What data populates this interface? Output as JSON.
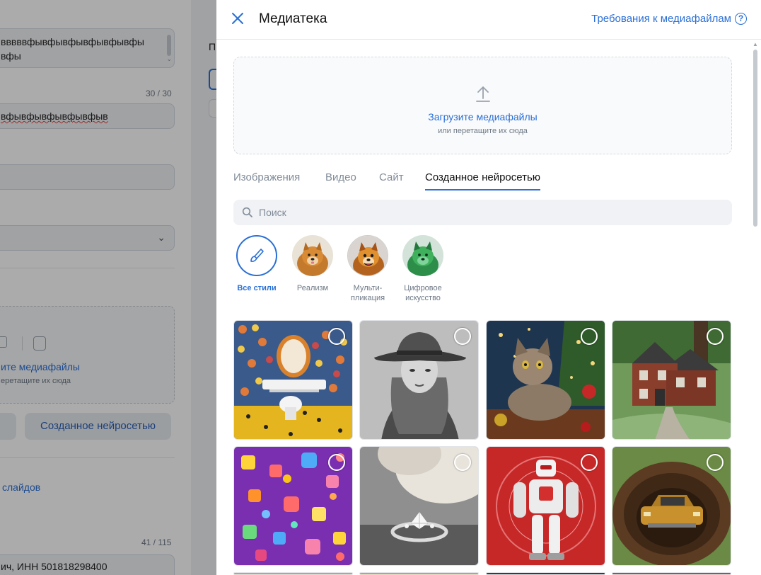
{
  "background_form": {
    "textarea_line1": "вввввфывфывфывфывфывфы",
    "textarea_line2": "вфы",
    "counter1": "30 / 30",
    "input_value": "вфывфывфывфывфыв",
    "upload_title": "ите медиафайлы",
    "upload_sub": "еретащите их сюда",
    "ai_button": "Созданное нейросетью",
    "slides_link": "слайдов",
    "counter2": "41 / 115",
    "inn_value": "ич, ИНН 501818298400",
    "right_label": "П"
  },
  "panel": {
    "title": "Медиатека",
    "requirements_link": "Требования к медиафайлам",
    "help_icon": "?",
    "upload": {
      "title": "Загрузите медиафайлы",
      "subtitle": "или перетащите их сюда"
    },
    "tabs": [
      {
        "label": "Изображения",
        "active": false
      },
      {
        "label": "Видео",
        "active": false
      },
      {
        "label": "Сайт",
        "active": false
      },
      {
        "label": "Созданное нейросетью",
        "active": true
      }
    ],
    "search": {
      "placeholder": "Поиск",
      "value": ""
    },
    "styles": [
      {
        "label": "Все стили",
        "icon": "brush-icon",
        "active": true
      },
      {
        "label": "Реализм",
        "icon": "dog-photo",
        "active": false
      },
      {
        "label": "Мульти-\nпликация",
        "icon": "dog-cartoon",
        "active": false
      },
      {
        "label": "Цифровое\nискусство",
        "icon": "dog-digital",
        "active": false
      }
    ],
    "images": [
      {
        "subject": "mosaic-bathroom"
      },
      {
        "subject": "woman-in-hat-bw"
      },
      {
        "subject": "cat-christmas"
      },
      {
        "subject": "brick-house"
      },
      {
        "subject": "purple-icons-pattern"
      },
      {
        "subject": "diamond-ring"
      },
      {
        "subject": "red-robot"
      },
      {
        "subject": "car-in-pit"
      }
    ]
  },
  "colors": {
    "accent": "#2a6fd6",
    "text_secondary": "#818c99",
    "surface": "#f0f2f5"
  }
}
